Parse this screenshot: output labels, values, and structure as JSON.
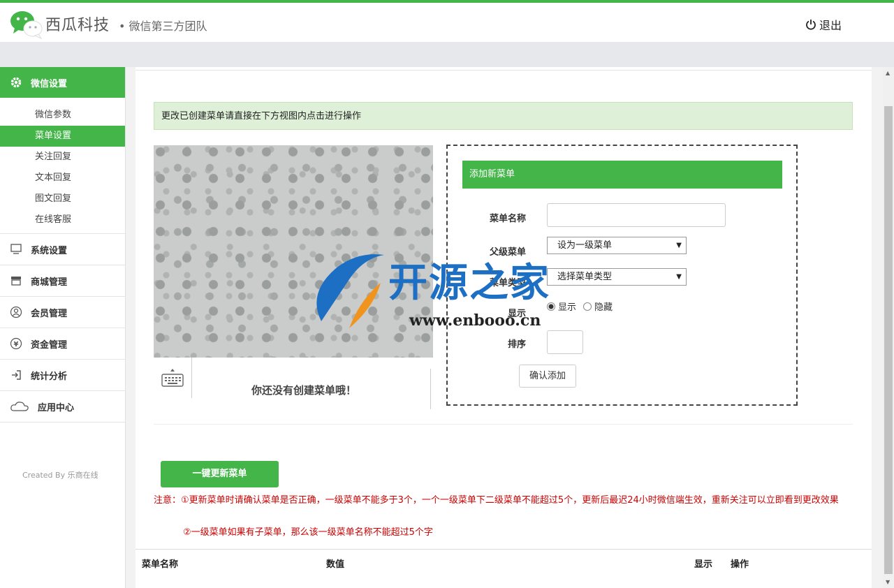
{
  "header": {
    "brand": "西瓜科技",
    "brand_sub": "• 微信第三方团队",
    "logout_label": "退出"
  },
  "sidebar": {
    "active_section": "微信设置",
    "sub_items": [
      "微信参数",
      "菜单设置",
      "关注回复",
      "文本回复",
      "图文回复",
      "在线客服"
    ],
    "active_sub": "菜单设置",
    "sections": [
      {
        "label": "系统设置",
        "icon": "monitor-icon"
      },
      {
        "label": "商城管理",
        "icon": "store-icon"
      },
      {
        "label": "会员管理",
        "icon": "user-icon"
      },
      {
        "label": "资金管理",
        "icon": "yen-icon"
      },
      {
        "label": "统计分析",
        "icon": "signin-icon"
      },
      {
        "label": "应用中心",
        "icon": "cloud-icon"
      }
    ],
    "created_by": "Created By 乐商在线"
  },
  "main": {
    "notice": "更改已创建菜单请直接在下方视图内点击进行操作",
    "no_menu_text": "你还没有创建菜单哦！",
    "form": {
      "title": "添加新菜单",
      "name_label": "菜单名称",
      "name_value": "",
      "parent_label": "父级菜单",
      "parent_value": "设为一级菜单",
      "type_label": "菜单类型",
      "type_value": "选择菜单类型",
      "show_label": "显示",
      "radio_show": "显示",
      "radio_hide": "隐藏",
      "order_label": "排序",
      "order_value": "",
      "submit_label": "确认添加"
    },
    "update_button": "一键更新菜单",
    "note_line1": "注意：①更新菜单时请确认菜单是否正确，一级菜单不能多于3个，一个一级菜单下二级菜单不能超过5个，更新后最迟24小时微信端生效，重新关注可以立即看到更改效果",
    "note_line2": "②一级菜单如果有子菜单，那么该一级菜单名称不能超过5个字",
    "table_headers": {
      "name": "菜单名称",
      "value": "数值",
      "show": "显示",
      "action": "操作"
    }
  },
  "watermark": {
    "title": "开源之家",
    "url": "www.enbooo.cn"
  },
  "colors": {
    "accent": "#44b549",
    "notice_bg": "#dff0d8",
    "warning": "#cc0000"
  }
}
